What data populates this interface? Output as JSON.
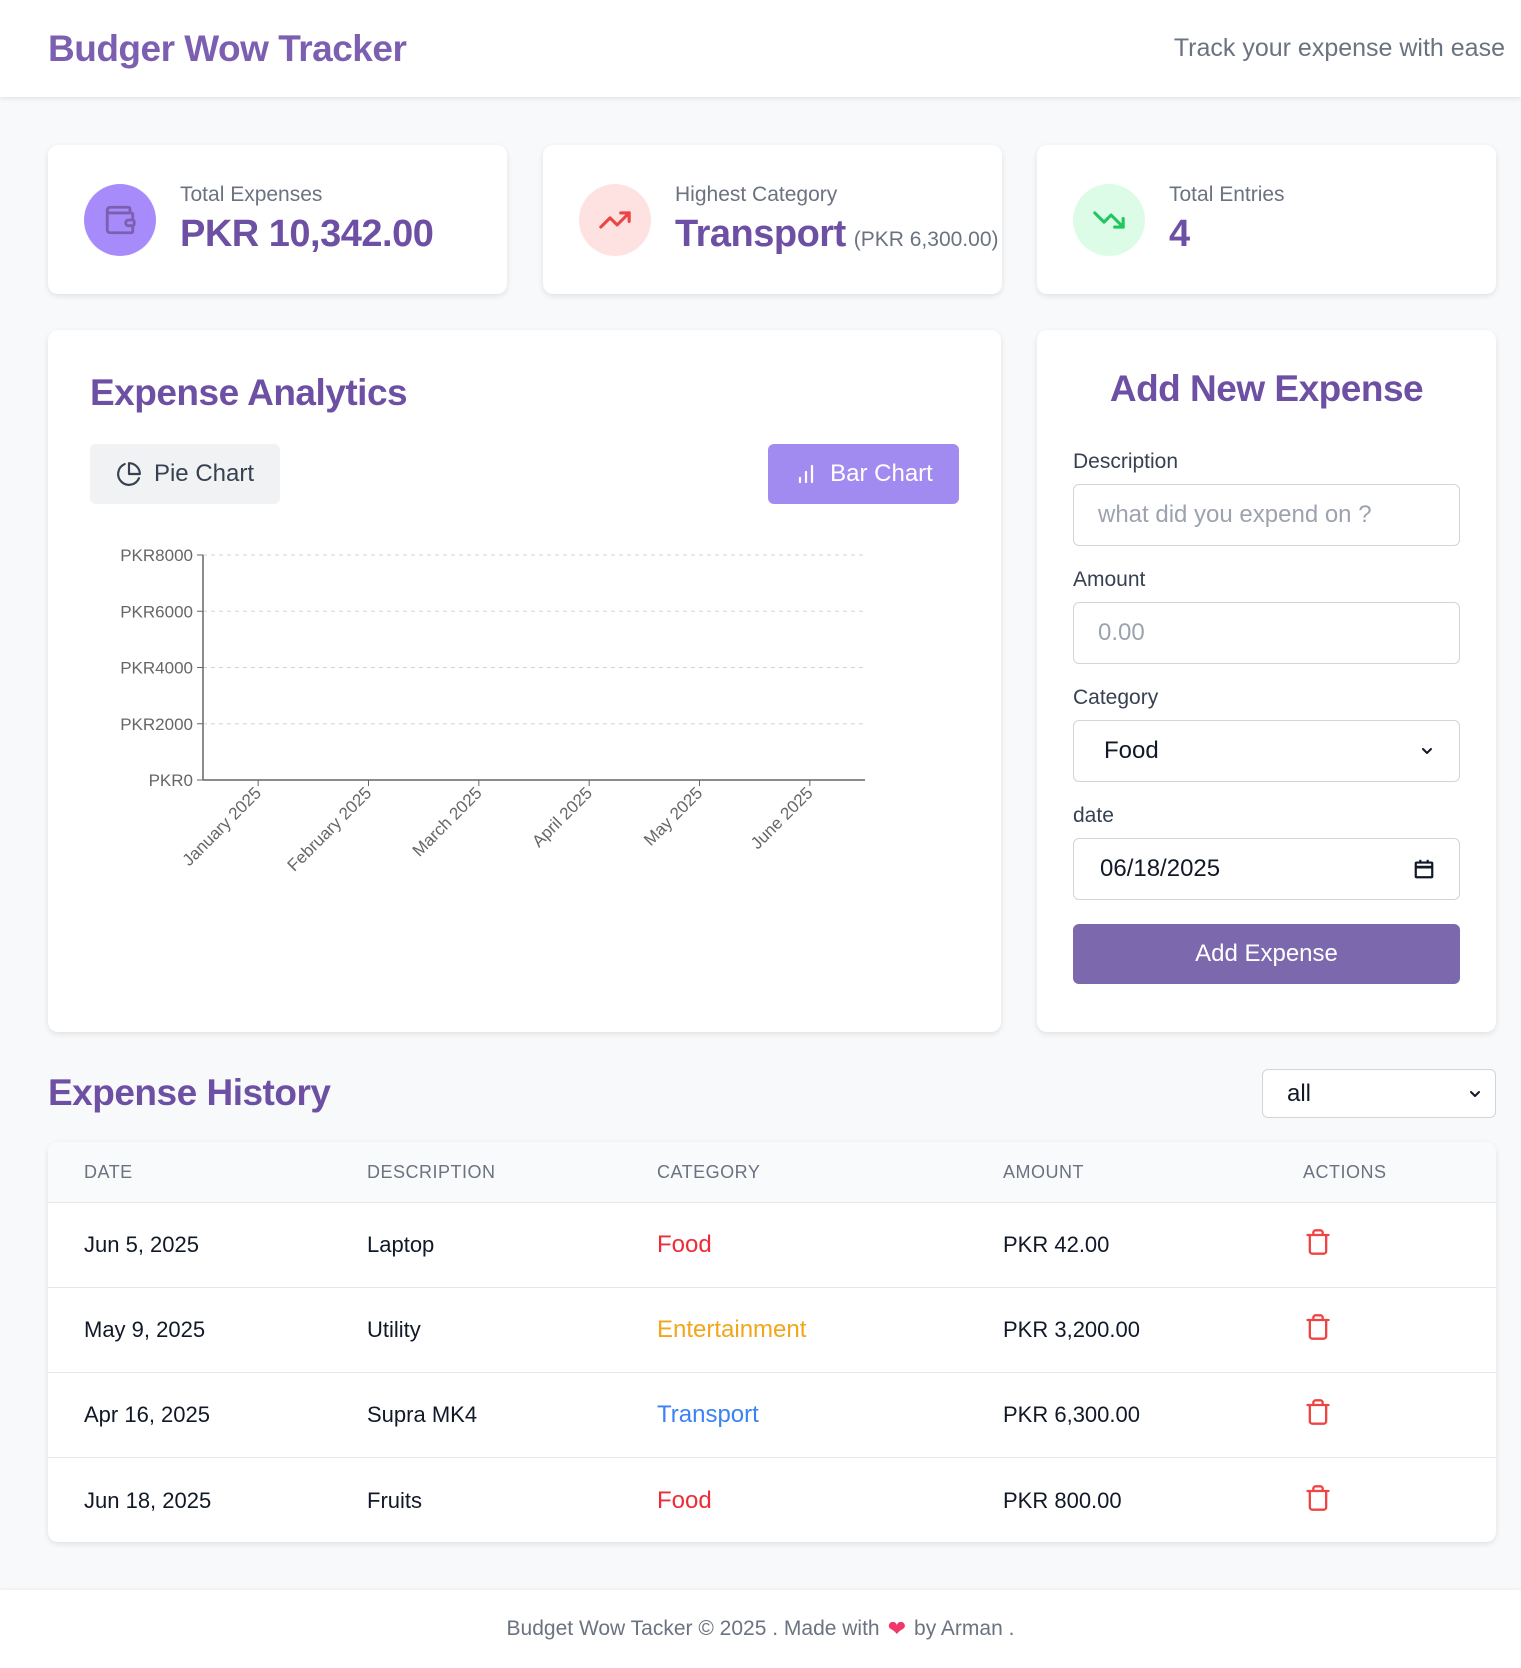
{
  "header": {
    "brand": "Budger Wow Tracker",
    "tagline": "Track your expense with ease"
  },
  "stats": [
    {
      "label": "Total Expenses",
      "value": "PKR 10,342.00",
      "icon": "wallet-icon",
      "icon_bg": "#a78bfa",
      "icon_color": "#7c5fb0"
    },
    {
      "label": "Highest Category",
      "value": "Transport",
      "sub": "(PKR 6,300.00)",
      "icon": "trending-up-icon",
      "icon_bg": "#fee2e2",
      "icon_color": "#ef4444"
    },
    {
      "label": "Total Entries",
      "value": "4",
      "icon": "trending-down-icon",
      "icon_bg": "#dcfce7",
      "icon_color": "#22c55e"
    }
  ],
  "analytics": {
    "title": "Expense Analytics",
    "pie_button": "Pie Chart",
    "bar_button": "Bar Chart",
    "active_view": "Bar Chart"
  },
  "chart_data": {
    "type": "bar",
    "categories": [
      "January 2025",
      "February 2025",
      "March 2025",
      "April 2025",
      "May 2025",
      "June 2025"
    ],
    "values": [
      0,
      0,
      0,
      0,
      0,
      0
    ],
    "yticks": [
      "PKR0",
      "PKR2000",
      "PKR4000",
      "PKR6000",
      "PKR8000"
    ],
    "ylim": [
      0,
      8000
    ],
    "grid": true,
    "grid_color": "#cbd5e1",
    "axis_color": "#666666"
  },
  "form": {
    "title": "Add New Expense",
    "description_label": "Description",
    "description_placeholder": "what did you expend on ?",
    "amount_label": "Amount",
    "amount_placeholder": "0.00",
    "category_label": "Category",
    "category_value": "Food",
    "date_label": "date",
    "date_value": "06/18/2025",
    "submit": "Add Expense"
  },
  "history": {
    "title": "Expense History",
    "filter_value": "all",
    "columns": [
      "DATE",
      "DESCRIPTION",
      "CATEGORY",
      "AMOUNT",
      "ACTIONS"
    ],
    "rows": [
      {
        "date": "Jun 5, 2025",
        "description": "Laptop",
        "category": "Food",
        "amount": "PKR 42.00"
      },
      {
        "date": "May 9, 2025",
        "description": "Utility",
        "category": "Entertainment",
        "amount": "PKR 3,200.00"
      },
      {
        "date": "Apr 16, 2025",
        "description": "Supra MK4",
        "category": "Transport",
        "amount": "PKR 6,300.00"
      },
      {
        "date": "Jun 18, 2025",
        "description": "Fruits",
        "category": "Food",
        "amount": "PKR 800.00"
      }
    ],
    "category_colors": {
      "Food": "#ef2b39",
      "Entertainment": "#f2a61a",
      "Transport": "#3b82f6"
    },
    "delete_icon": "trash-icon",
    "delete_color": "#ef4444"
  },
  "footer": {
    "left": "Budget Wow Tacker © 2025 . Made with",
    "heart_icon": "heart-icon",
    "right": "by Arman ."
  }
}
